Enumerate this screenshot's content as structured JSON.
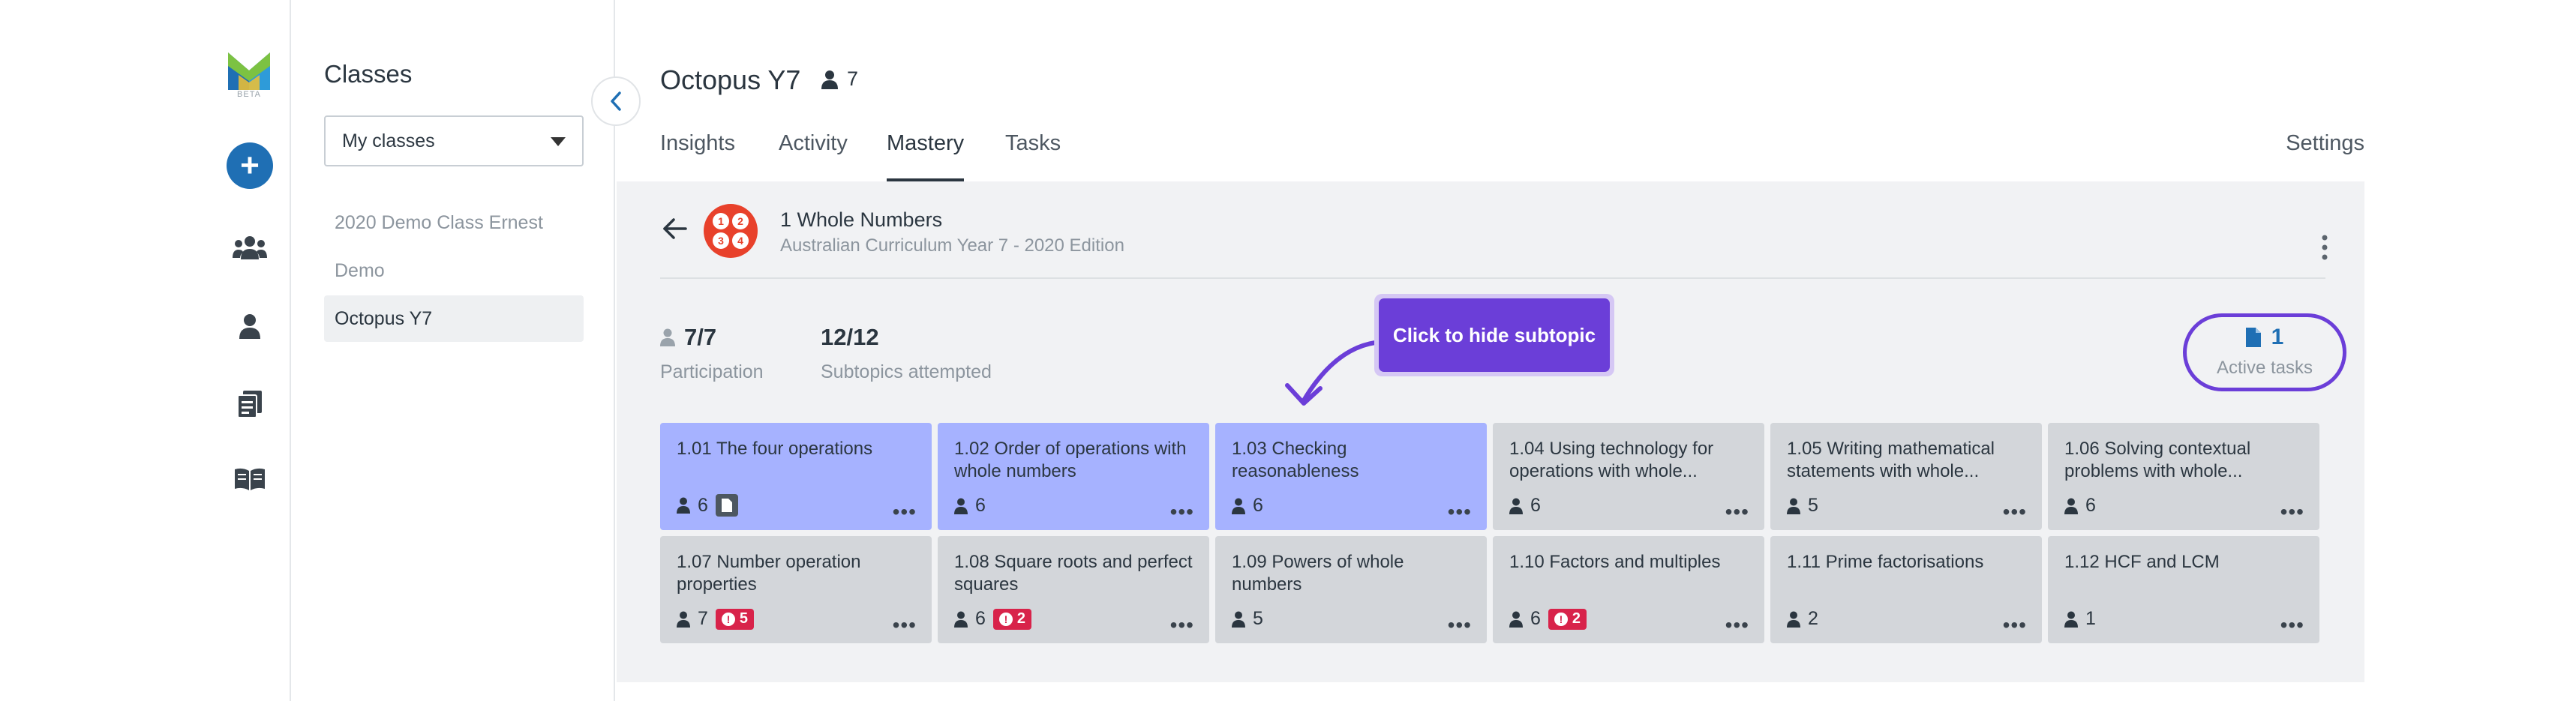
{
  "brand": {
    "logo_badge": "BETA",
    "colors": {
      "accent": "#1f6fb4",
      "highlight": "#6b3ed8",
      "subtopic_on": "#a6b2ff",
      "warning": "#d8234a"
    }
  },
  "rail": {
    "icons": [
      "add-icon",
      "classes-icon",
      "user-icon",
      "tasks-icon",
      "book-icon"
    ]
  },
  "classes_panel": {
    "title": "Classes",
    "filter_value": "My classes",
    "items": [
      "2020 Demo Class Ernest",
      "Demo",
      "Octopus Y7"
    ],
    "active_index": 2
  },
  "header": {
    "class_name": "Octopus Y7",
    "student_count": "7"
  },
  "tabs": [
    {
      "label": "Insights"
    },
    {
      "label": "Activity"
    },
    {
      "label": "Mastery"
    },
    {
      "label": "Tasks"
    }
  ],
  "settings_label": "Settings",
  "topic": {
    "badge_digits": [
      "1",
      "2",
      "3",
      "4"
    ],
    "title": "1 Whole Numbers",
    "subtitle": "Australian Curriculum Year 7 - 2020 Edition"
  },
  "stats": {
    "participation_value": "7/7",
    "participation_label": "Participation",
    "attempted_value": "12/12",
    "attempted_label": "Subtopics attempted",
    "active_tasks_value": "1",
    "active_tasks_label": "Active tasks"
  },
  "tooltip": "Click to hide subtopic",
  "subtopics": [
    {
      "title": "1.01 The four operations",
      "students": "6",
      "on": true,
      "doc": true,
      "warn": ""
    },
    {
      "title": "1.02 Order of operations with whole numbers",
      "students": "6",
      "on": true,
      "doc": false,
      "warn": ""
    },
    {
      "title": "1.03 Checking reasonableness",
      "students": "6",
      "on": true,
      "doc": false,
      "warn": ""
    },
    {
      "title": "1.04 Using technology for operations with whole...",
      "students": "6",
      "on": false,
      "doc": false,
      "warn": ""
    },
    {
      "title": "1.05 Writing mathematical statements with whole...",
      "students": "5",
      "on": false,
      "doc": false,
      "warn": ""
    },
    {
      "title": "1.06 Solving contextual problems with whole...",
      "students": "6",
      "on": false,
      "doc": false,
      "warn": ""
    },
    {
      "title": "1.07 Number operation properties",
      "students": "7",
      "on": false,
      "doc": false,
      "warn": "5"
    },
    {
      "title": "1.08 Square roots and perfect squares",
      "students": "6",
      "on": false,
      "doc": false,
      "warn": "2"
    },
    {
      "title": "1.09 Powers of whole numbers",
      "students": "5",
      "on": false,
      "doc": false,
      "warn": ""
    },
    {
      "title": "1.10 Factors and multiples",
      "students": "6",
      "on": false,
      "doc": false,
      "warn": "2"
    },
    {
      "title": "1.11 Prime factorisations",
      "students": "2",
      "on": false,
      "doc": false,
      "warn": ""
    },
    {
      "title": "1.12 HCF and LCM",
      "students": "1",
      "on": false,
      "doc": false,
      "warn": ""
    }
  ]
}
